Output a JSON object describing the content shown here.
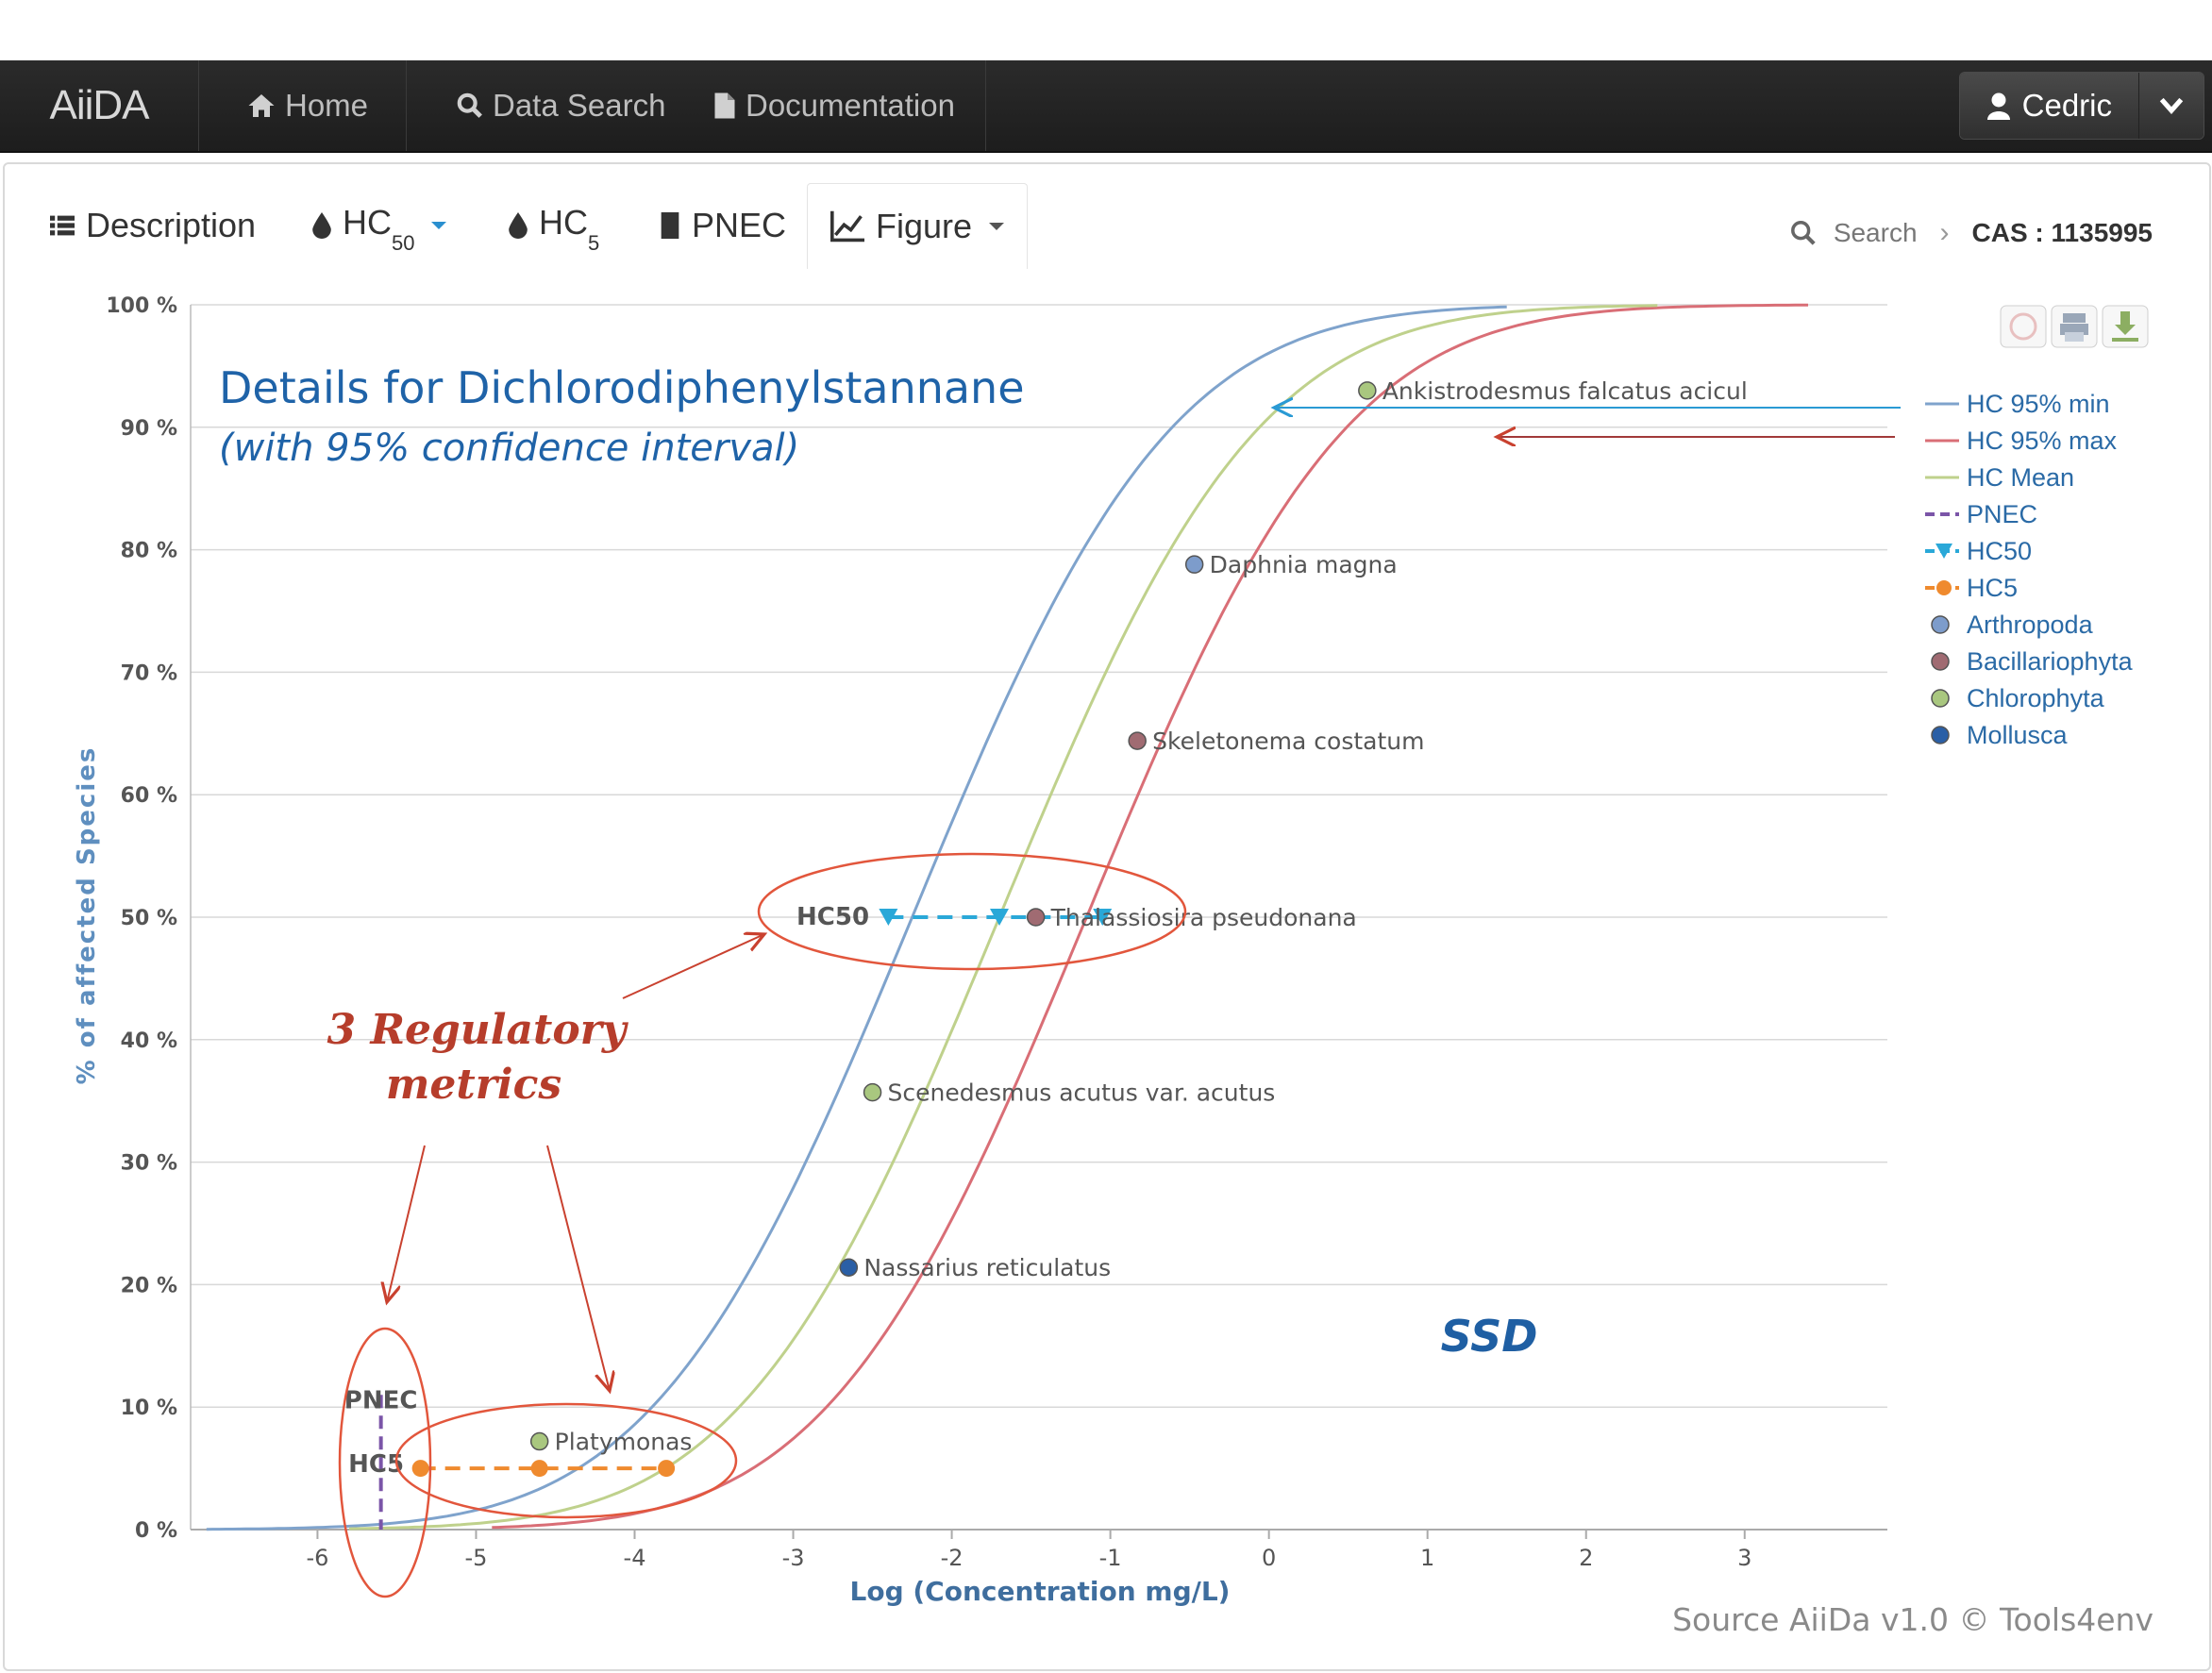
{
  "navbar": {
    "brand": "AiiDA",
    "items": [
      {
        "label": "Home",
        "icon": "home-icon"
      },
      {
        "label": "Data Search",
        "icon": "search-icon"
      },
      {
        "label": "Documentation",
        "icon": "document-icon"
      }
    ],
    "user": {
      "label": "Cedric",
      "icon": "user-icon"
    }
  },
  "tabs": [
    {
      "label": "Description",
      "icon": "list-icon"
    },
    {
      "label": "HC",
      "sub": "50",
      "icon": "drop-icon"
    },
    {
      "label": "HC",
      "sub": "5",
      "icon": "drop-icon"
    },
    {
      "label": "PNEC",
      "icon": "book-icon"
    },
    {
      "label": "Figure",
      "icon": "chart-icon"
    }
  ],
  "breadcrumb": {
    "search": "Search",
    "cas": "CAS : 1135995"
  },
  "colors": {
    "hc_min": "#7fa3cc",
    "hc_max": "#d96e76",
    "hc_mean": "#bfd18c",
    "pnec": "#7b55a8",
    "hc50": "#2aa8d8",
    "hc5": "#ef8a2e",
    "arthropoda": "#7d9ccb",
    "bacillariophyta": "#a06b72",
    "chlorophyta": "#a9c77f",
    "mollusca": "#2a5fa6",
    "annotation": "#e2563c",
    "annotation_text": "#b63d2b",
    "title": "#1f63a8"
  },
  "chart_data": {
    "type": "line",
    "title": "Details for Dichlorodiphenylstannane",
    "subtitle": "(with 95% confidence interval)",
    "xlabel": "Log (Concentration mg/L)",
    "ylabel": "% of affected Species",
    "xlim": [
      -6.8,
      3.9
    ],
    "ylim": [
      0,
      100
    ],
    "x_ticks": [
      "-6",
      "-5",
      "-4",
      "-3",
      "-2",
      "-1",
      "0",
      "1",
      "2",
      "3"
    ],
    "x_tick_values": [
      -6,
      -5,
      -4,
      -3,
      -2,
      -1,
      0,
      1,
      2,
      3
    ],
    "y_ticks": [
      "0 %",
      "10 %",
      "20 %",
      "30 %",
      "40 %",
      "50 %",
      "60 %",
      "70 %",
      "80 %",
      "90 %",
      "100 %"
    ],
    "y_tick_values": [
      0,
      10,
      20,
      30,
      40,
      50,
      60,
      70,
      80,
      90,
      100
    ],
    "grid": true,
    "legend_position": "right",
    "series": [
      {
        "name": "HC 95% min",
        "kind": "curve",
        "mu": -2.25,
        "sigma": 1.28,
        "x_range": [
          -6.7,
          1.5
        ]
      },
      {
        "name": "HC 95% max",
        "kind": "curve",
        "mu": -1.15,
        "sigma": 1.28,
        "x_range": [
          -4.9,
          3.4
        ]
      },
      {
        "name": "HC Mean",
        "kind": "curve",
        "mu": -1.7,
        "sigma": 1.28,
        "x_range": [
          -5.8,
          2.45
        ]
      },
      {
        "name": "PNEC",
        "kind": "vline",
        "x": -5.6
      },
      {
        "name": "HC50",
        "kind": "hline",
        "y": 50,
        "x": [
          -2.4,
          -1.7,
          -1.05
        ]
      },
      {
        "name": "HC5",
        "kind": "hline",
        "y": 5,
        "x": [
          -5.35,
          -4.6,
          -3.8
        ]
      },
      {
        "name": "Arthropoda",
        "kind": "category"
      },
      {
        "name": "Bacillariophyta",
        "kind": "category"
      },
      {
        "name": "Chlorophyta",
        "kind": "category"
      },
      {
        "name": "Mollusca",
        "kind": "category"
      }
    ],
    "species_points": [
      {
        "label": "Ankistrodesmus falcatus acicul",
        "x": 0.62,
        "y": 93,
        "group": "Chlorophyta"
      },
      {
        "label": "Daphnia magna",
        "x": -0.47,
        "y": 78.8,
        "group": "Arthropoda"
      },
      {
        "label": "Skeletonema costatum",
        "x": -0.83,
        "y": 64.4,
        "group": "Bacillariophyta"
      },
      {
        "label": "Thalassiosira pseudonana",
        "x": -1.47,
        "y": 50,
        "group": "Bacillariophyta"
      },
      {
        "label": "Scenedesmus acutus var. acutus",
        "x": -2.5,
        "y": 35.7,
        "group": "Chlorophyta"
      },
      {
        "label": "Nassarius reticulatus",
        "x": -2.65,
        "y": 21.4,
        "group": "Mollusca"
      },
      {
        "label": "Platymonas",
        "x": -4.6,
        "y": 7.2,
        "group": "Chlorophyta"
      }
    ],
    "inline_labels": {
      "hc50": "HC50",
      "pnec": "PNEC",
      "hc5": "HC5"
    },
    "annotations": {
      "metrics_line1": "3 Regulatory",
      "metrics_line2": "metrics",
      "ssd": "SSD"
    },
    "credit": "Source AiiDa v1.0 © Tools4env"
  }
}
